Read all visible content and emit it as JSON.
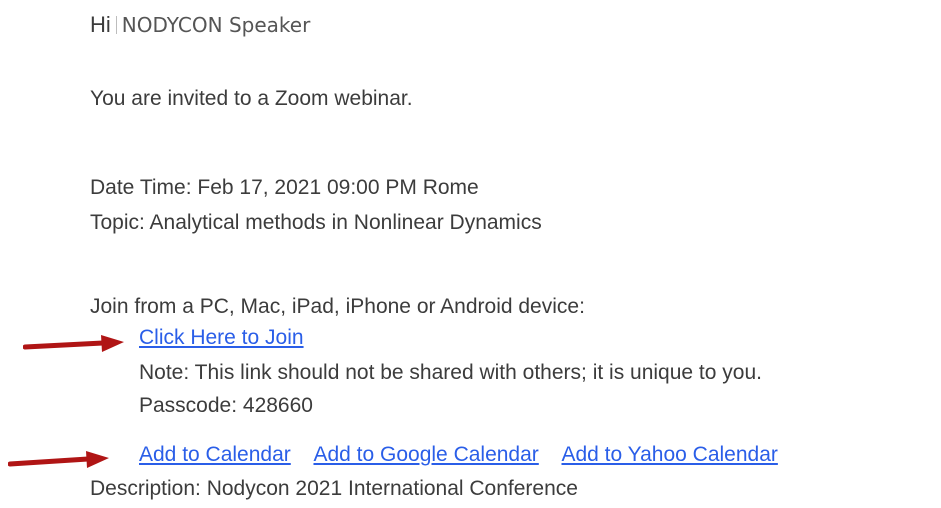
{
  "greeting": {
    "hi": "Hi",
    "name": "NODYCON Speaker"
  },
  "message": {
    "invite": "You are invited to a Zoom webinar.",
    "datetime": "Date Time: Feb 17, 2021 09:00 PM Rome",
    "topic": "Topic: Analytical methods in Nonlinear Dynamics",
    "join_from": "Join from a PC, Mac, iPad, iPhone or Android device:",
    "join_link": "Click Here to Join",
    "note": "Note: This link should not be shared with others; it is unique to you.",
    "passcode": "Passcode: 428660",
    "calendar_links": [
      "Add to Calendar",
      "Add to Google Calendar",
      "Add to Yahoo Calendar"
    ],
    "description": "Description: Nodycon 2021 International Conference"
  },
  "colors": {
    "link": "#2a5ee8",
    "text": "#3c3c3c",
    "arrow": "#b01515"
  },
  "icons": [
    "arrow-right-icon",
    "arrow-right-icon"
  ]
}
